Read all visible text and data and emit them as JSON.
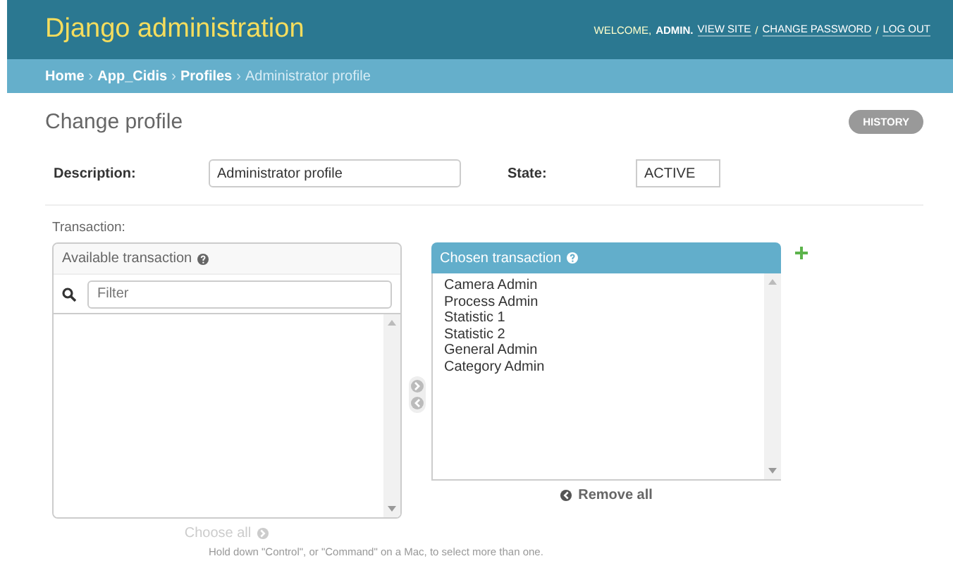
{
  "header": {
    "title": "Django administration",
    "welcome": "WELCOME,",
    "user": "ADMIN.",
    "separator": "/",
    "links": [
      "VIEW SITE",
      "CHANGE PASSWORD",
      "LOG OUT"
    ]
  },
  "breadcrumbs": {
    "separator": "›",
    "items": [
      {
        "label": "Home",
        "current": false
      },
      {
        "label": "App_Cidis",
        "current": false
      },
      {
        "label": "Profiles",
        "current": false
      },
      {
        "label": "Administrator profile",
        "current": true
      }
    ]
  },
  "page_title": "Change profile",
  "history_button": "HISTORY",
  "fields": [
    {
      "kind": "text",
      "label": "Description:",
      "value": "Administrator profile"
    },
    {
      "kind": "select",
      "label": "State:",
      "value": "ACTIVE"
    }
  ],
  "selector": {
    "label": "Transaction:",
    "available": {
      "title": "Available transaction",
      "filter_placeholder": "Filter"
    },
    "chosen": {
      "title": "Chosen transaction",
      "items": [
        "Camera Admin",
        "Process Admin",
        "Statistic 1",
        "Statistic 2",
        "General Admin",
        "Category Admin"
      ]
    },
    "choose_all": {
      "label": "Choose all",
      "disabled": true
    },
    "remove_all": {
      "label": "Remove all",
      "disabled": false
    },
    "help": "Hold down \"Control\", or \"Command\" on a Mac, to select more than one."
  }
}
